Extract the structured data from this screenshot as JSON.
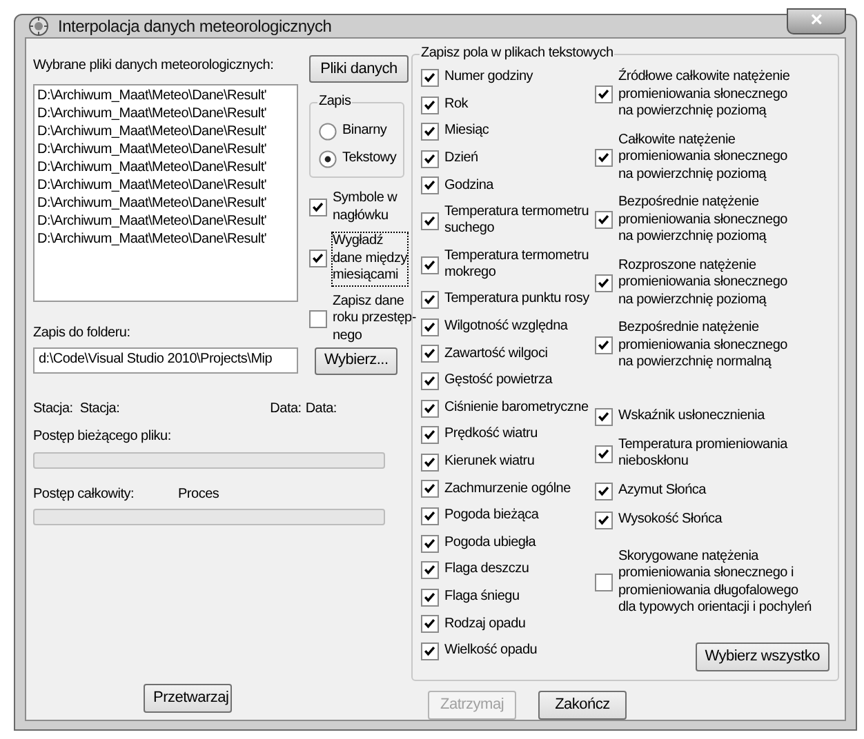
{
  "window": {
    "title": "Interpolacja danych meteorologicznych",
    "close": "×"
  },
  "files": {
    "label": "Wybrane pliki danych meteorologicznych:",
    "button": "Pliki danych",
    "items": [
      "D:\\Archiwum_Maat\\Meteo\\Dane\\Result'",
      "D:\\Archiwum_Maat\\Meteo\\Dane\\Result'",
      "D:\\Archiwum_Maat\\Meteo\\Dane\\Result'",
      "D:\\Archiwum_Maat\\Meteo\\Dane\\Result'",
      "D:\\Archiwum_Maat\\Meteo\\Dane\\Result'",
      "D:\\Archiwum_Maat\\Meteo\\Dane\\Result'",
      "D:\\Archiwum_Maat\\Meteo\\Dane\\Result'",
      "D:\\Archiwum_Maat\\Meteo\\Dane\\Result'",
      "D:\\Archiwum_Maat\\Meteo\\Dane\\Result'"
    ]
  },
  "format": {
    "title": "Zapis",
    "options": [
      {
        "label": "Binarny",
        "selected": false
      },
      {
        "label": "Tekstowy",
        "selected": true
      }
    ]
  },
  "options": [
    {
      "label": "Symbole w\nnagłówku",
      "checked": true,
      "focused": false
    },
    {
      "label": "Wygładź\ndane między\nmiesiącami",
      "checked": true,
      "focused": true
    },
    {
      "label": "Zapisz dane\nroku przestęp-\nnego",
      "checked": false,
      "focused": false
    }
  ],
  "folder": {
    "label": "Zapis do folderu:",
    "value": "d:\\Code\\Visual Studio 2010\\Projects\\Mip",
    "button": "Wybierz..."
  },
  "status": {
    "station_label": "Stacja:",
    "station_value": "Stacja:",
    "date_label": "Data:",
    "date_value": "Data:"
  },
  "progress": [
    {
      "label": "Postęp bieżącego pliku:",
      "level": 0
    },
    {
      "label": "Postęp całkowity:",
      "status": "Proces",
      "level": 0
    }
  ],
  "fields": {
    "title": "Zapisz pola w plikach tekstowych",
    "left": [
      {
        "label": "Numer godziny",
        "checked": true
      },
      {
        "label": "Rok",
        "checked": true
      },
      {
        "label": "Miesiąc",
        "checked": true
      },
      {
        "label": "Dzień",
        "checked": true
      },
      {
        "label": "Godzina",
        "checked": true
      },
      {
        "label": "Temperatura termometru\nsuchego",
        "checked": true
      },
      {
        "label": "Temperatura termometru\nmokrego",
        "checked": true
      },
      {
        "label": "Temperatura punktu rosy",
        "checked": true
      },
      {
        "label": "Wilgotność względna",
        "checked": true
      },
      {
        "label": "Zawartość wilgoci",
        "checked": true
      },
      {
        "label": "Gęstość powietrza",
        "checked": true
      },
      {
        "label": "Ciśnienie barometryczne",
        "checked": true
      },
      {
        "label": "Prędkość wiatru",
        "checked": true
      },
      {
        "label": "Kierunek wiatru",
        "checked": true
      },
      {
        "label": "Zachmurzenie ogólne",
        "checked": true
      },
      {
        "label": "Pogoda bieżąca",
        "checked": true
      },
      {
        "label": "Pogoda ubiegła",
        "checked": true
      },
      {
        "label": "Flaga deszczu",
        "checked": true
      },
      {
        "label": "Flaga śniegu",
        "checked": true
      },
      {
        "label": "Rodzaj opadu",
        "checked": true
      },
      {
        "label": "Wielkość opadu",
        "checked": true
      }
    ],
    "right": [
      {
        "label": "Źródłowe całkowite natężenie\npromieniowania słonecznego\nna powierzchnię poziomą",
        "checked": true
      },
      {
        "label": "Całkowite natężenie\npromieniowania słonecznego\nna powierzchnię poziomą",
        "checked": true
      },
      {
        "label": "Bezpośrednie natężenie\npromieniowania słonecznego\nna powierzchnię poziomą",
        "checked": true
      },
      {
        "label": "Rozproszone natężenie\npromieniowania słonecznego\nna powierzchnię poziomą",
        "checked": true
      },
      {
        "label": "Bezpośrednie natężenie\npromieniowania słonecznego\nna powierzchnię normalną",
        "checked": true
      },
      {
        "label": "Wskaźnik usłonecznienia",
        "checked": true
      },
      {
        "label": "Temperatura promieniowania\nnieboskłonu",
        "checked": true
      },
      {
        "label": "Azymut Słońca",
        "checked": true
      },
      {
        "label": "Wysokość Słońca",
        "checked": true
      },
      {
        "label": "Skorygowane natężenia\npromieniowania słonecznego i\npromieniowania długofalowego\ndla typowych orientacji i pochyleń",
        "checked": false
      }
    ],
    "select_all": "Wybierz wszystko"
  },
  "buttons": [
    {
      "label": "Przetwarzaj",
      "disabled": false
    },
    {
      "label": "Zatrzymaj",
      "disabled": true
    },
    {
      "label": "Zakończ",
      "disabled": false
    }
  ]
}
